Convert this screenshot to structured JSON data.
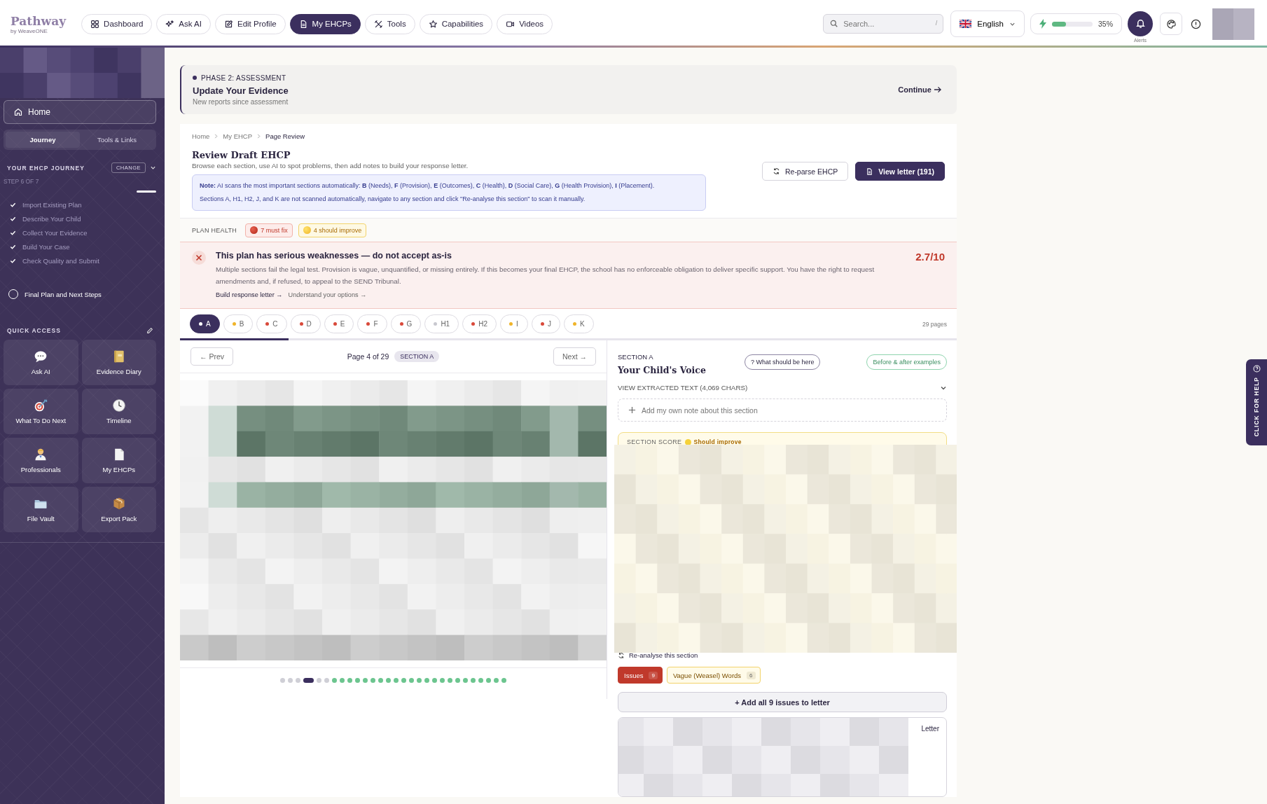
{
  "brand": {
    "name": "Pathway",
    "tagline": "by WeaveONE"
  },
  "nav": [
    {
      "label": "Dashboard",
      "selected": false
    },
    {
      "label": "Ask AI",
      "selected": false
    },
    {
      "label": "Edit Profile",
      "selected": false
    },
    {
      "label": "My EHCPs",
      "selected": true
    },
    {
      "label": "Tools",
      "selected": false
    },
    {
      "label": "Capabilities",
      "selected": false
    },
    {
      "label": "Videos",
      "selected": false
    }
  ],
  "search": {
    "placeholder": "Search...",
    "shortcut": "/"
  },
  "language": {
    "label": "English"
  },
  "progress": {
    "level": 0.35,
    "reading": "35%"
  },
  "alerts": {
    "label": "Alerts"
  },
  "sidebar": {
    "home": "Home",
    "tabs": [
      {
        "label": "Journey",
        "selected": true
      },
      {
        "label": "Tools & Links",
        "selected": false
      }
    ],
    "journey_title": "YOUR EHCP JOURNEY",
    "change": "CHANGE",
    "step": "STEP 6 OF 7",
    "steps": [
      {
        "label": "Import Existing Plan",
        "done": true
      },
      {
        "label": "Describe Your Child",
        "done": true
      },
      {
        "label": "Collect Your Evidence",
        "done": true
      },
      {
        "label": "Build Your Case",
        "done": true
      },
      {
        "label": "Check Quality and Submit",
        "done": true
      },
      {
        "label": "Final Plan and Next Steps",
        "done": false
      }
    ],
    "quick_access_title": "QUICK ACCESS",
    "quick_access": [
      "Ask AI",
      "Evidence Diary",
      "What To Do Next",
      "Timeline",
      "Professionals",
      "My EHCPs",
      "File Vault",
      "Export Pack"
    ]
  },
  "phase": {
    "label": "PHASE 2: ASSESSMENT",
    "title": "Update Your Evidence",
    "subtitle": "New reports since assessment",
    "action": "Continue"
  },
  "breadcrumb": [
    "Home",
    "My EHCP",
    "Page Review"
  ],
  "review": {
    "title": "Review Draft EHCP",
    "subtitle": "Browse each section, use AI to spot problems, then add notes to build your response letter.",
    "note": "**Note:** AI scans the most important sections automatically: **B** (Needs), **F** (Provision), **E** (Outcomes), **C** (Health), **D** (Social Care), **G** (Health Provision), **I** (Placement).",
    "note_2": "Sections A, H1, H2, J, and K are not scanned automatically, navigate to any section and click \"Re-analyse this section\" to scan it manually.",
    "buttons": [
      {
        "label": "Re-parse EHCP",
        "kind": "secondary"
      },
      {
        "label": "View letter (191)",
        "kind": "primary"
      }
    ]
  },
  "plan_health": {
    "label": "PLAN HEALTH",
    "badges": [
      {
        "label": "7 must fix",
        "kind": "danger"
      },
      {
        "label": "4 should improve",
        "kind": "warning"
      }
    ]
  },
  "verdict": {
    "title": "This plan has serious weaknesses — do not accept as-is",
    "text": "Multiple sections fail the legal test. Provision is vague, unquantified, or missing entirely. If this becomes your final EHCP, the school has no enforceable obligation to deliver specific support. You have the right to request amendments and, if refused, to appeal to the SEND Tribunal.",
    "links": [
      "Build response letter →",
      "Understand your options →"
    ],
    "score": "2.7/10"
  },
  "section_tabs": [
    {
      "label": "A",
      "color": "#ffffff",
      "selected": true
    },
    {
      "label": "B",
      "color": "#f0b429",
      "selected": false
    },
    {
      "label": "C",
      "color": "#d9493a",
      "selected": false
    },
    {
      "label": "D",
      "color": "#d9493a",
      "selected": false
    },
    {
      "label": "E",
      "color": "#d9493a",
      "selected": false
    },
    {
      "label": "F",
      "color": "#d9493a",
      "selected": false
    },
    {
      "label": "G",
      "color": "#d9493a",
      "selected": false
    },
    {
      "label": "H1",
      "color": "#c8c8cf",
      "selected": false
    },
    {
      "label": "H2",
      "color": "#d9493a",
      "selected": false
    },
    {
      "label": "I",
      "color": "#f0b429",
      "selected": false
    },
    {
      "label": "J",
      "color": "#d9493a",
      "selected": false
    },
    {
      "label": "K",
      "color": "#f0b429",
      "selected": false
    }
  ],
  "pages_count": "29 pages",
  "viewer": {
    "prev": "← Prev",
    "page": "Page 4 of 29",
    "section": "SECTION A",
    "next": "Next →",
    "dots": [
      {
        "color": "#cfcfd6",
        "selected": false
      },
      {
        "color": "#cfcfd6",
        "selected": false
      },
      {
        "color": "#cfcfd6",
        "selected": false
      },
      {
        "color": "#3b2f5e",
        "selected": true
      },
      {
        "color": "#cfcfd6",
        "selected": false
      },
      {
        "color": "#cfcfd6",
        "selected": false
      },
      {
        "color": "#6cc58f",
        "selected": false
      },
      {
        "color": "#6cc58f",
        "selected": false
      },
      {
        "color": "#6cc58f",
        "selected": false
      },
      {
        "color": "#6cc58f",
        "selected": false
      },
      {
        "color": "#6cc58f",
        "selected": false
      },
      {
        "color": "#6cc58f",
        "selected": false
      },
      {
        "color": "#6cc58f",
        "selected": false
      },
      {
        "color": "#6cc58f",
        "selected": false
      },
      {
        "color": "#6cc58f",
        "selected": false
      },
      {
        "color": "#6cc58f",
        "selected": false
      },
      {
        "color": "#6cc58f",
        "selected": false
      },
      {
        "color": "#6cc58f",
        "selected": false
      },
      {
        "color": "#6cc58f",
        "selected": false
      },
      {
        "color": "#6cc58f",
        "selected": false
      },
      {
        "color": "#6cc58f",
        "selected": false
      },
      {
        "color": "#6cc58f",
        "selected": false
      },
      {
        "color": "#6cc58f",
        "selected": false
      },
      {
        "color": "#6cc58f",
        "selected": false
      },
      {
        "color": "#6cc58f",
        "selected": false
      },
      {
        "color": "#6cc58f",
        "selected": false
      },
      {
        "color": "#6cc58f",
        "selected": false
      },
      {
        "color": "#6cc58f",
        "selected": false
      },
      {
        "color": "#6cc58f",
        "selected": false
      }
    ]
  },
  "section_panel": {
    "eyebrow": "SECTION A",
    "title": "Your Child's Voice",
    "help": "? What should be here",
    "examples": "Before & after examples",
    "extracted": "VIEW EXTRACTED TEXT (4,069 CHARS)",
    "note_action": "Add my own note about this section",
    "score_label": "SECTION SCORE",
    "score_status": "Should improve",
    "reanalyse": "Re-analyse this section",
    "tags": [
      {
        "label": "Issues",
        "count": "9",
        "kind": "danger"
      },
      {
        "label": "Vague (Weasel) Words",
        "count": "6",
        "kind": "warning"
      }
    ],
    "add_all": "+ Add all 9 issues to letter",
    "letter": "Letter"
  },
  "help_tab": "CLICK FOR HELP"
}
